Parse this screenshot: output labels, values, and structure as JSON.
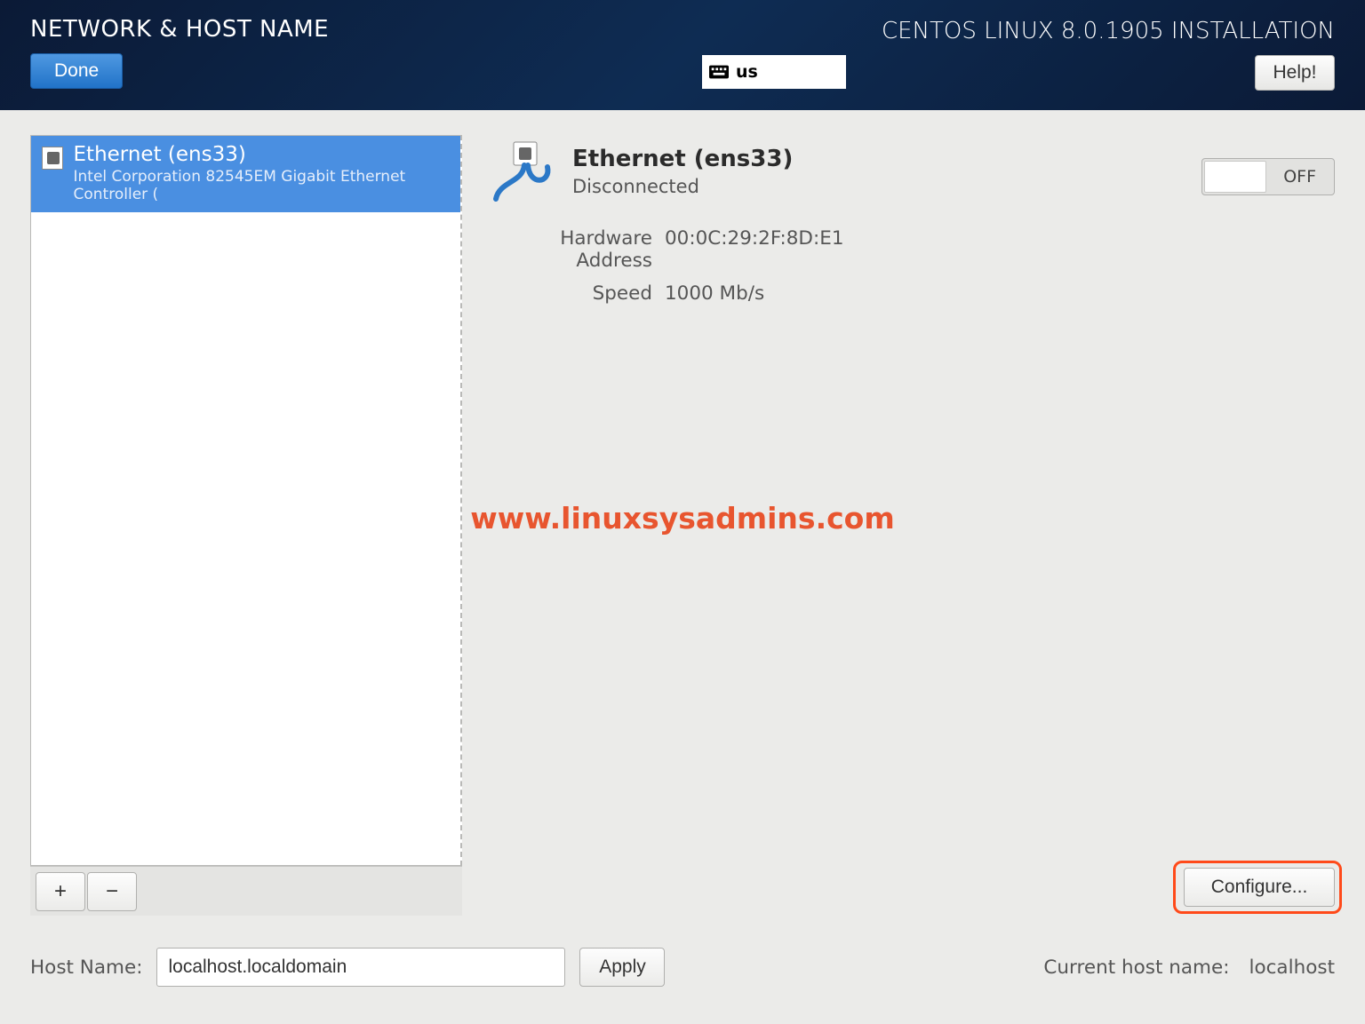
{
  "header": {
    "title": "NETWORK & HOST NAME",
    "product": "CENTOS LINUX 8.0.1905 INSTALLATION",
    "done_label": "Done",
    "keyboard_layout": "us",
    "help_label": "Help!"
  },
  "devices": [
    {
      "name": "Ethernet (ens33)",
      "vendor": "Intel Corporation 82545EM Gigabit Ethernet Controller ("
    }
  ],
  "list_buttons": {
    "add": "+",
    "remove": "−"
  },
  "detail": {
    "title": "Ethernet (ens33)",
    "status": "Disconnected",
    "toggle_label": "OFF",
    "hw_label": "Hardware Address",
    "hw_value": "00:0C:29:2F:8D:E1",
    "speed_label": "Speed",
    "speed_value": "1000 Mb/s",
    "configure_label": "Configure..."
  },
  "watermark": "www.linuxsysadmins.com",
  "hostname": {
    "label": "Host Name:",
    "value": "localhost.localdomain",
    "apply_label": "Apply",
    "current_label": "Current host name:",
    "current_value": "localhost"
  }
}
